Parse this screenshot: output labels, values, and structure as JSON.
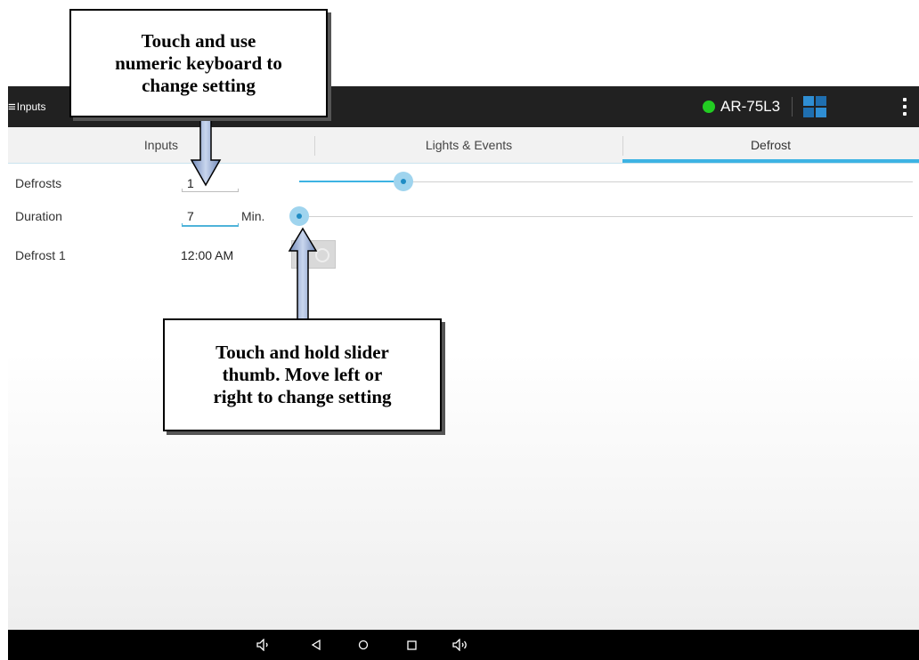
{
  "appbar": {
    "menu_label": "Inputs",
    "menu_icon": "≡",
    "device_name": "AR-75L3",
    "status_color": "#22cc22",
    "accent_color": "#3db3e3"
  },
  "tabs": [
    {
      "label": "Inputs"
    },
    {
      "label": "Lights & Events"
    },
    {
      "label": "Defrost",
      "active": true
    }
  ],
  "settings": {
    "defrosts": {
      "label": "Defrosts",
      "value": "1",
      "slider_fraction": 0.17
    },
    "duration": {
      "label": "Duration",
      "value": "7",
      "unit": "Min.",
      "slider_fraction": 0.0
    },
    "defrost1": {
      "label": "Defrost 1",
      "time": "12:00 AM"
    }
  },
  "callouts": {
    "keyboard": [
      "Touch and use",
      "numeric keyboard to",
      "change setting"
    ],
    "slider": [
      "Touch and hold slider",
      "thumb.  Move left or",
      "right to change setting"
    ]
  },
  "navbar": {
    "icons": [
      "volume-down-icon",
      "back-icon",
      "home-icon",
      "recents-icon",
      "volume-up-icon"
    ]
  }
}
